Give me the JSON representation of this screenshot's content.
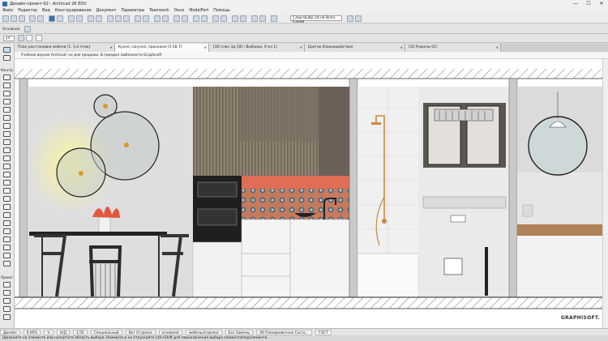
{
  "window": {
    "title": "Дизайн-проект-02 - Archicad 26 EDU",
    "controls": [
      "—",
      "☐",
      "✕"
    ]
  },
  "menu": [
    "Файл",
    "Редактор",
    "Вид",
    "Конструирование",
    "Документ",
    "Параметры",
    "Teamwork",
    "Окно",
    "ModelPort",
    "Помощь"
  ],
  "toolbar": {
    "layer_combo": "Слои Выбр.3d не Всех Слоев",
    "basic_label": "Основная"
  },
  "toolbar3": {
    "zoom_combo": "ул"
  },
  "tabs": [
    {
      "label": "План расстановки мебели [1. 1-й этаж]",
      "active": false
    },
    {
      "label": "Кухня, санузел, прихожая [5-5В 7]",
      "active": true
    },
    {
      "label": "{3D план 3д [3D / Выборка, Угол 1]",
      "active": false
    },
    {
      "label": "Бритор Взаимодействия",
      "active": false
    },
    {
      "label": "[10 Разрезы 01]",
      "active": false
    }
  ],
  "notice": "Учебная версия Archicad: не для продажи. В порядке любезности Graphisoft",
  "left_panel": {
    "label_top": "Констр",
    "label_mid": "Проект"
  },
  "status_bar": {
    "cells": [
      "Дизайн",
      "0,00%",
      "↻",
      "Н/Д",
      "1:50",
      "Специальный",
      "Вет Отделка",
      "основной",
      "мебель/отделка",
      "Без Замены",
      "06 Планировочное Состо...",
      "ГОСТ"
    ]
  },
  "status_hint": "Щелкните на элементе или начертите область выбора. Нажмите и не отпускайте Ctrl+Shift для переключения выбора элемента/подэлемента.",
  "brand": "GRAPHISOFT."
}
